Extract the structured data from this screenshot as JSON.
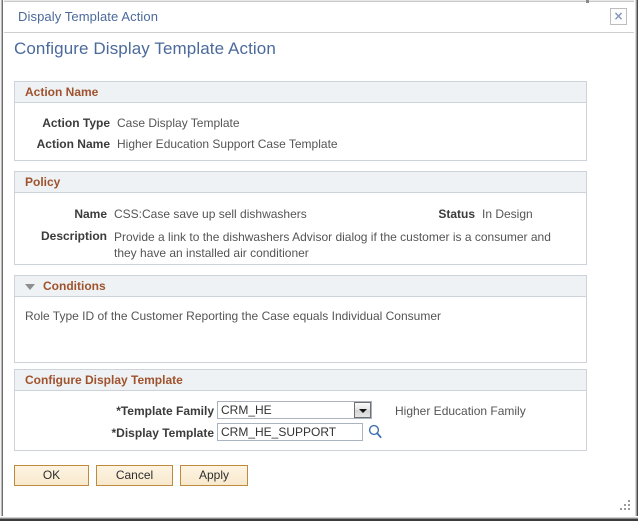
{
  "window": {
    "title": "Dispaly Template Action",
    "close_label": "×",
    "page_title": "Configure Display Template Action"
  },
  "action_name_section": {
    "header": "Action Name",
    "fields": [
      {
        "label": "Action Type",
        "value": "Case Display Template"
      },
      {
        "label": "Action Name",
        "value": "Higher Education Support Case Template"
      }
    ]
  },
  "policy_section": {
    "header": "Policy",
    "name_label": "Name",
    "name_value": "CSS:Case save up sell dishwashers",
    "status_label": "Status",
    "status_value": "In Design",
    "description_label": "Description",
    "description_value": "Provide a link to the dishwashers Advisor dialog if the customer is a consumer and they have an installed air conditioner"
  },
  "conditions_section": {
    "header": "Conditions",
    "toggle_state": "expanded",
    "text": "Role Type ID of the Customer Reporting the Case equals Individual Consumer"
  },
  "configure_section": {
    "header": "Configure Display Template",
    "template_family_label": "*Template Family",
    "template_family_value": "CRM_HE",
    "template_family_description": "Higher Education Family",
    "display_template_label": "*Display Template",
    "display_template_value": "CRM_HE_SUPPORT"
  },
  "buttons": {
    "ok": "OK",
    "cancel": "Cancel",
    "apply": "Apply"
  },
  "colors": {
    "header_text": "#a0522d",
    "title_text": "#4b6a9b",
    "panel_header_bg": "#eef2f5",
    "panel_border": "#cdd3d8",
    "button_border": "#c08a3e",
    "button_bg": "#f9ecd2"
  }
}
